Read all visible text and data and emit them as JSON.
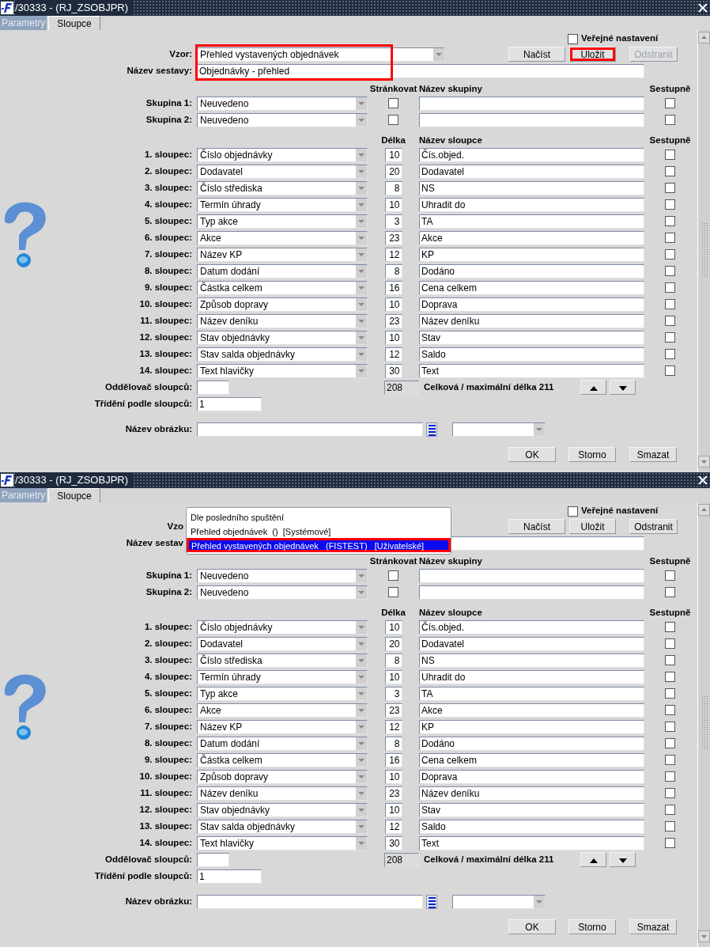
{
  "windows": [
    {
      "title": "/30333 - (RJ_ZSOBJPR)",
      "tabs": [
        {
          "label": "Parametry",
          "selected": false
        },
        {
          "label": "Sloupce",
          "selected": true
        }
      ],
      "public_setting": {
        "label": "Veřejné nastavení",
        "checked": false
      },
      "template": {
        "label": "Vzor:",
        "value": "Přehled vystavených objednávek",
        "highlighted": true
      },
      "report_name": {
        "label": "Název sestavy:",
        "value": "Objednávky - přehled"
      },
      "top_buttons": [
        {
          "label": "Načíst",
          "disabled": false,
          "highlighted": false
        },
        {
          "label": "Uložit",
          "disabled": false,
          "highlighted": true
        },
        {
          "label": "Odstranit",
          "disabled": true,
          "highlighted": false
        }
      ],
      "group_headers": [
        "Stránkovat",
        "Název skupiny",
        "Sestupně"
      ],
      "groups": [
        {
          "label": "Skupina 1:",
          "value": "Neuvedeno",
          "paging": false,
          "descending": false
        },
        {
          "label": "Skupina 2:",
          "value": "Neuvedeno",
          "paging": false,
          "descending": false
        }
      ],
      "column_headers": [
        "Délka",
        "Název sloupce",
        "Sestupně"
      ],
      "columns": [
        {
          "label": "1. sloupec:",
          "value": "Číslo objednávky",
          "length": "10",
          "name": "Čís.objed.",
          "descending": false
        },
        {
          "label": "2. sloupec:",
          "value": "Dodavatel",
          "length": "20",
          "name": "Dodavatel",
          "descending": false
        },
        {
          "label": "3. sloupec:",
          "value": "Číslo střediska",
          "length": "8",
          "name": "NS",
          "descending": false
        },
        {
          "label": "4. sloupec:",
          "value": "Termín úhrady",
          "length": "10",
          "name": "Uhradit do",
          "descending": false
        },
        {
          "label": "5. sloupec:",
          "value": "Typ akce",
          "length": "3",
          "name": "TA",
          "descending": false
        },
        {
          "label": "6. sloupec:",
          "value": "Akce",
          "length": "23",
          "name": "Akce",
          "descending": false
        },
        {
          "label": "7. sloupec:",
          "value": "Název KP",
          "length": "12",
          "name": "KP",
          "descending": false
        },
        {
          "label": "8. sloupec:",
          "value": "Datum dodání",
          "length": "8",
          "name": "Dodáno",
          "descending": false
        },
        {
          "label": "9. sloupec:",
          "value": "Částka celkem",
          "length": "16",
          "name": "Cena celkem",
          "descending": false
        },
        {
          "label": "10. sloupec:",
          "value": "Způsob dopravy",
          "length": "10",
          "name": "Doprava",
          "descending": false
        },
        {
          "label": "11. sloupec:",
          "value": "Název deníku",
          "length": "23",
          "name": "Název deníku",
          "descending": false
        },
        {
          "label": "12. sloupec:",
          "value": "Stav objednávky",
          "length": "10",
          "name": "Stav",
          "descending": false
        },
        {
          "label": "13. sloupec:",
          "value": "Stav salda objednávky",
          "length": "12",
          "name": "Saldo",
          "descending": false
        },
        {
          "label": "14. sloupec:",
          "value": "Text hlavičky",
          "length": "30",
          "name": "Text",
          "descending": false
        }
      ],
      "separator": {
        "label": "Oddělovač sloupců:"
      },
      "total": {
        "value": "208",
        "label": "Celková / maximální délka 211"
      },
      "sort": {
        "label": "Třídění podle sloupců:",
        "value": "1"
      },
      "image_name": {
        "label": "Název obrázku:"
      },
      "bottom_buttons": [
        {
          "label": "OK"
        },
        {
          "label": "Storno"
        },
        {
          "label": "Smazat"
        }
      ]
    },
    {
      "title": "/30333 - (RJ_ZSOBJPR)",
      "tabs": [
        {
          "label": "Parametry",
          "selected": false
        },
        {
          "label": "Sloupce",
          "selected": true
        }
      ],
      "public_setting": {
        "label": "Veřejné nastavení",
        "checked": false
      },
      "template": {
        "label": "Vzo"
      },
      "report_name": {
        "label": "Název sestav"
      },
      "top_buttons": [
        {
          "label": "Načíst",
          "disabled": false,
          "highlighted": false
        },
        {
          "label": "Uložit",
          "disabled": false,
          "highlighted": false
        },
        {
          "label": "Odstranit",
          "disabled": false,
          "highlighted": false
        }
      ],
      "dropdown": {
        "items": [
          {
            "label": "Dle posledního spuštění",
            "selected": false,
            "highlighted": false
          },
          {
            "label": "Přehled objednávek  ()  [Systémové]",
            "selected": false,
            "highlighted": false
          },
          {
            "label": "Přehled vystavených objednávek   (FISTEST)   [Uživatelské]",
            "selected": true,
            "highlighted": true
          }
        ]
      },
      "group_headers": [
        "Stránkovat",
        "Název skupiny",
        "Sestupně"
      ],
      "groups": [
        {
          "label": "Skupina 1:",
          "value": "Neuvedeno",
          "paging": false,
          "descending": false
        },
        {
          "label": "Skupina 2:",
          "value": "Neuvedeno",
          "paging": false,
          "descending": false
        }
      ],
      "column_headers": [
        "Délka",
        "Název sloupce",
        "Sestupně"
      ],
      "columns": [
        {
          "label": "1. sloupec:",
          "value": "Číslo objednávky",
          "length": "10",
          "name": "Čís.objed.",
          "descending": false
        },
        {
          "label": "2. sloupec:",
          "value": "Dodavatel",
          "length": "20",
          "name": "Dodavatel",
          "descending": false
        },
        {
          "label": "3. sloupec:",
          "value": "Číslo střediska",
          "length": "8",
          "name": "NS",
          "descending": false
        },
        {
          "label": "4. sloupec:",
          "value": "Termín úhrady",
          "length": "10",
          "name": "Uhradit do",
          "descending": false
        },
        {
          "label": "5. sloupec:",
          "value": "Typ akce",
          "length": "3",
          "name": "TA",
          "descending": false
        },
        {
          "label": "6. sloupec:",
          "value": "Akce",
          "length": "23",
          "name": "Akce",
          "descending": false
        },
        {
          "label": "7. sloupec:",
          "value": "Název KP",
          "length": "12",
          "name": "KP",
          "descending": false
        },
        {
          "label": "8. sloupec:",
          "value": "Datum dodání",
          "length": "8",
          "name": "Dodáno",
          "descending": false
        },
        {
          "label": "9. sloupec:",
          "value": "Částka celkem",
          "length": "16",
          "name": "Cena celkem",
          "descending": false
        },
        {
          "label": "10. sloupec:",
          "value": "Způsob dopravy",
          "length": "10",
          "name": "Doprava",
          "descending": false
        },
        {
          "label": "11. sloupec:",
          "value": "Název deníku",
          "length": "23",
          "name": "Název deníku",
          "descending": false
        },
        {
          "label": "12. sloupec:",
          "value": "Stav objednávky",
          "length": "10",
          "name": "Stav",
          "descending": false
        },
        {
          "label": "13. sloupec:",
          "value": "Stav salda objednávky",
          "length": "12",
          "name": "Saldo",
          "descending": false
        },
        {
          "label": "14. sloupec:",
          "value": "Text hlavičky",
          "length": "30",
          "name": "Text",
          "descending": false
        }
      ],
      "separator": {
        "label": "Oddělovač sloupců:"
      },
      "total": {
        "value": "208",
        "label": "Celková / maximální délka 211"
      },
      "sort": {
        "label": "Třídění podle sloupců:",
        "value": "1"
      },
      "image_name": {
        "label": "Název obrázku:"
      },
      "bottom_buttons": [
        {
          "label": "OK"
        },
        {
          "label": "Storno"
        },
        {
          "label": "Smazat"
        }
      ]
    }
  ]
}
